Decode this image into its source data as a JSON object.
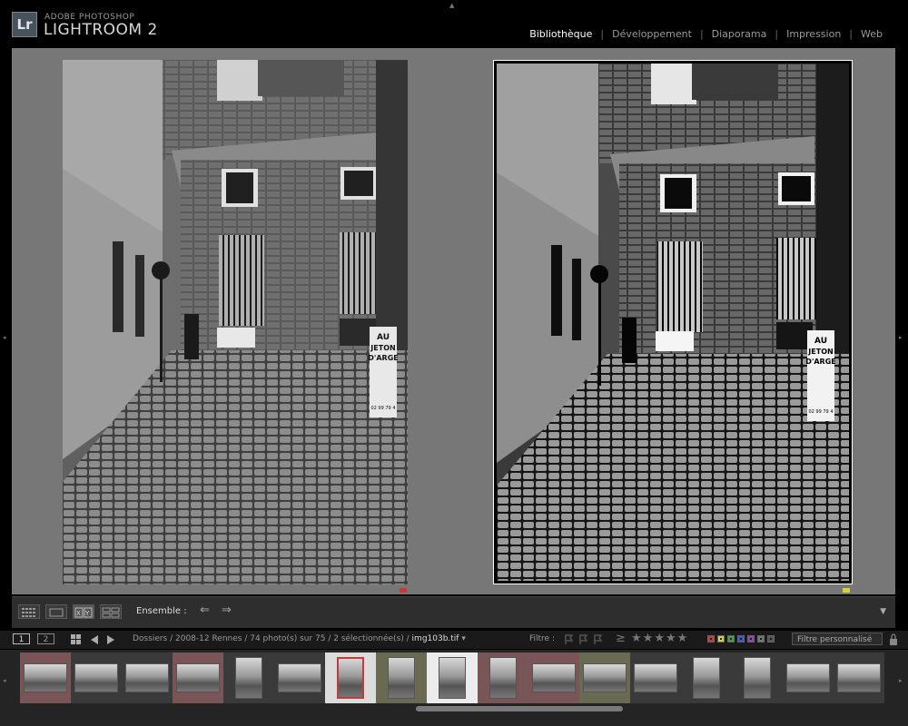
{
  "header": {
    "logo_text": "Lr",
    "brand_top": "ADOBE PHOTOSHOP",
    "brand_name": "LIGHTROOM 2",
    "modules": [
      "Bibliothèque",
      "Développement",
      "Diaporama",
      "Impression",
      "Web"
    ],
    "active_module": "Bibliothèque",
    "separator": "|"
  },
  "compare": {
    "left_photo_flag_color": "#c63a3a",
    "right_photo_flag_color": "#d6d040",
    "sign_lines": [
      "AU",
      "JETON",
      "D'ARGE",
      "02 99 79 4"
    ]
  },
  "toolbar": {
    "ensemble_label": "Ensemble :",
    "prev_arrow": "⇐",
    "next_arrow": "⇒",
    "menu_arrow": "▼"
  },
  "filmstrip_bar": {
    "page1": "1",
    "page2": "2",
    "breadcrumb": "Dossiers / 2008-12 Rennes / 74 photo(s) sur 75 / 2 sélectionnée(s) /",
    "current_file": "img103b.tif",
    "file_menu_arrow": "▾",
    "filter_label": "Filtre :",
    "stars": "≥ ★★★★★",
    "filter_preset": "Filtre personnalisé",
    "color_filters": [
      "#c63a3a",
      "#d6d040",
      "#43a043",
      "#3f55c0",
      "#9a3fb0",
      "#777777",
      "#555555"
    ]
  },
  "filmstrip": {
    "cells": [
      {
        "bg": "#7a5558",
        "orient": "land",
        "sel": false
      },
      {
        "bg": "#3a3a3a",
        "orient": "land",
        "sel": false
      },
      {
        "bg": "#3a3a3a",
        "orient": "land",
        "sel": false
      },
      {
        "bg": "#7a5558",
        "orient": "land",
        "sel": false
      },
      {
        "bg": "#3a3a3a",
        "orient": "port",
        "sel": false
      },
      {
        "bg": "#3a3a3a",
        "orient": "land",
        "sel": false
      },
      {
        "bg": "#dcdcdc",
        "orient": "port",
        "sel": true,
        "redframe": true
      },
      {
        "bg": "#6a6a52",
        "orient": "port",
        "sel": false
      },
      {
        "bg": "#ececec",
        "orient": "port",
        "sel": true
      },
      {
        "bg": "#7a5558",
        "orient": "port",
        "sel": false
      },
      {
        "bg": "#7a5558",
        "orient": "land",
        "sel": false
      },
      {
        "bg": "#6a6a52",
        "orient": "land",
        "sel": false
      },
      {
        "bg": "#3a3a3a",
        "orient": "land",
        "sel": false
      },
      {
        "bg": "#3a3a3a",
        "orient": "port",
        "sel": false
      },
      {
        "bg": "#3a3a3a",
        "orient": "port",
        "sel": false
      },
      {
        "bg": "#3a3a3a",
        "orient": "land",
        "sel": false
      },
      {
        "bg": "#3a3a3a",
        "orient": "land",
        "sel": false
      }
    ]
  }
}
